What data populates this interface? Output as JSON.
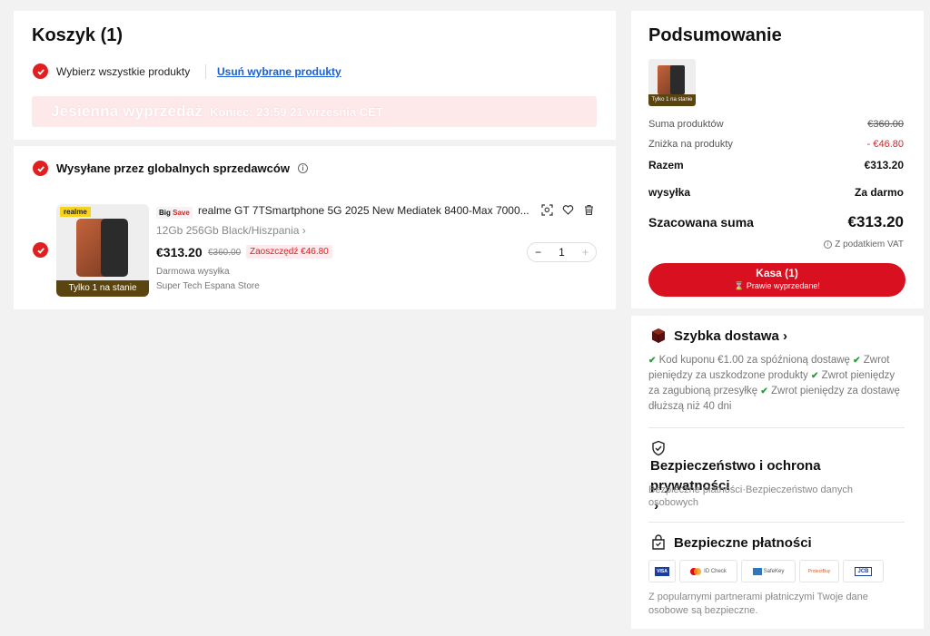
{
  "cart": {
    "title": "Koszyk (1)",
    "select_all_label": "Wybierz wszystkie produkty",
    "remove_selected_label": "Usuń wybrane produkty",
    "promo_title": "Jesienna wyprzedaż",
    "promo_deadline": "Koniec: 23:59 21 września CET"
  },
  "shipping_group": {
    "label": "Wysyłane przez globalnych sprzedawców",
    "info_icon": "info-icon"
  },
  "item": {
    "badge_big": "Big",
    "badge_save": "Save",
    "thumb_brand": "realme",
    "thumb_stock": "Tylko 1 na stanie",
    "title": "realme GT 7TSmartphone 5G 2025 New Mediatek 8400-Max 7000...",
    "variant": "12Gb 256Gb Black/Hiszpania",
    "price": "€313.20",
    "old_price": "€360.00",
    "savings": "Zaoszczędź €46.80",
    "shipping": "Darmowa wysyłka",
    "store": "Super Tech Espana Store",
    "quantity": "1",
    "minus": "−",
    "plus": "+"
  },
  "summary": {
    "title": "Podsumowanie",
    "thumb_stock": "Tylko 1 na stanie",
    "rows": [
      {
        "label": "Suma produktów",
        "value": "€360.00"
      },
      {
        "label": "Zniżka na produkty",
        "value": "- €46.80"
      },
      {
        "label": "Razem",
        "value": "€313.20"
      },
      {
        "label": "wysyłka",
        "value": "Za darmo"
      },
      {
        "label": "Szacowana suma",
        "value": "€313.20"
      }
    ],
    "vat_note": "Z podatkiem VAT",
    "checkout_label": "Kasa (1)",
    "checkout_sub": "⌛ Prawie wyprzedane!"
  },
  "benefits": {
    "fast_delivery": {
      "title": "Szybka dostawa",
      "items": [
        "Kod kuponu €1.00 za spóźnioną dostawę",
        "Zwrot pieniędzy za uszkodzone produkty",
        "Zwrot pieniędzy za zagubioną przesyłkę",
        "Zwrot pieniędzy za dostawę dłuższą niż 40 dni"
      ]
    },
    "security": {
      "title": "Bezpieczeństwo i ochrona prywatności",
      "text": "Bezpieczne płatności·Bezpieczeństwo danych osobowych"
    },
    "payments": {
      "title": "Bezpieczne płatności",
      "methods": [
        "VISA",
        "ID Check",
        "SafeKey",
        "ProtectBuy",
        "JCB"
      ],
      "text": "Z popularnymi partnerami płatniczymi Twoje dane osobowe są bezpieczne."
    }
  },
  "colors": {
    "accent": "#d8101f",
    "link": "#1a5fd6",
    "check_green": "#2a9d3a"
  }
}
